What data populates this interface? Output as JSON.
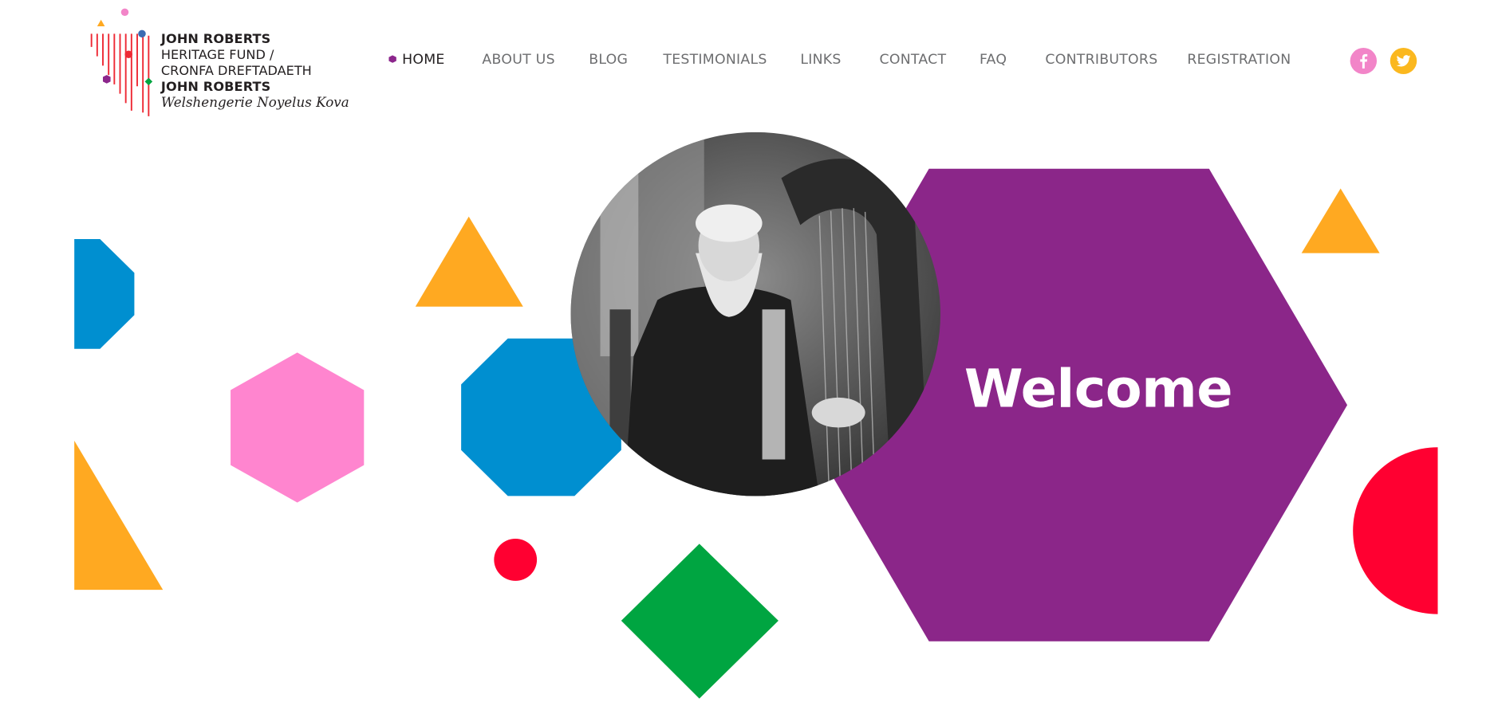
{
  "logo": {
    "line1": "JOHN ROBERTS",
    "line2": "HERITAGE FUND /",
    "line3": "CRONFA DREFTADAETH",
    "line4": "JOHN ROBERTS",
    "line5": "Welshengerie Noyelus Kova"
  },
  "nav": {
    "items": [
      {
        "label": "HOME",
        "active": true
      },
      {
        "label": "ABOUT US",
        "active": false
      },
      {
        "label": "BLOG",
        "active": false
      },
      {
        "label": "TESTIMONIALS",
        "active": false
      },
      {
        "label": "LINKS",
        "active": false
      },
      {
        "label": "CONTACT",
        "active": false
      },
      {
        "label": "FAQ",
        "active": false
      },
      {
        "label": "CONTRIBUTORS",
        "active": false
      },
      {
        "label": "REGISTRATION",
        "active": false
      }
    ],
    "active_marker_color": "#8c268c"
  },
  "social": {
    "facebook_icon": "facebook-icon",
    "facebook_color": "#f285c8",
    "twitter_icon": "twitter-icon",
    "twitter_color": "#fbb81f"
  },
  "hero": {
    "welcome_text": "Welcome",
    "portrait_icon": "portrait-photo-harpist",
    "colors": {
      "purple": "#8b2689",
      "blue": "#008fd0",
      "pink": "#ff85cf",
      "orange": "#ffa921",
      "red": "#ff0031",
      "green": "#00a541"
    }
  }
}
